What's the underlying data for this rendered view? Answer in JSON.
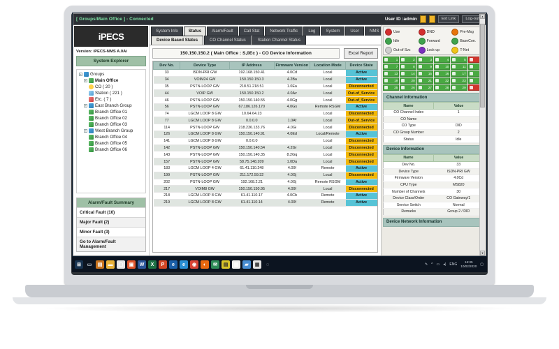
{
  "window": {
    "header_title": "[ Groups/Main Office ] - Connected",
    "user_label": "User ID :admin",
    "ext_link_label": "Ext Link",
    "logout_label": "Log-out"
  },
  "sidebar": {
    "logo_text": "iPECS",
    "version": "Version: iPECS-NMS A.0Ai",
    "explorer_title": "System Explorer",
    "tree": [
      {
        "label": "Groups",
        "depth": 0,
        "icon": "groups-icon",
        "bold": false
      },
      {
        "label": "Main Office",
        "depth": 1,
        "icon": "office-icon",
        "bold": true
      },
      {
        "label": "CO ( 20 )",
        "depth": 2,
        "icon": "co-icon",
        "bold": false
      },
      {
        "label": "Station ( 221 )",
        "depth": 2,
        "icon": "station-icon",
        "bold": false
      },
      {
        "label": "Etc. ( 7 )",
        "depth": 2,
        "icon": "etc-icon",
        "bold": false
      },
      {
        "label": "East Branch Group",
        "depth": 1,
        "icon": "groups-icon",
        "bold": false
      },
      {
        "label": "Branch Office 01",
        "depth": 2,
        "icon": "office-icon",
        "bold": false
      },
      {
        "label": "Branch Office 02",
        "depth": 2,
        "icon": "office-icon",
        "bold": false
      },
      {
        "label": "Branch Office 03",
        "depth": 2,
        "icon": "office-icon",
        "bold": false
      },
      {
        "label": "West Branch Group",
        "depth": 1,
        "icon": "groups-icon",
        "bold": false
      },
      {
        "label": "Branch Office 04",
        "depth": 2,
        "icon": "office-icon",
        "bold": false
      },
      {
        "label": "Branch Office 05",
        "depth": 2,
        "icon": "office-icon",
        "bold": false
      },
      {
        "label": "Branch Office 06",
        "depth": 2,
        "icon": "office-icon",
        "bold": false
      }
    ],
    "alarm_title": "Alarm/Fault Summary",
    "alarm_rows": [
      "Critical Fault (10)",
      "Major Fault (2)",
      "Minor Fault (3)",
      "Go to Alarm/Fault Management"
    ]
  },
  "tabs": {
    "primary": [
      "System Info",
      "Status",
      "Alarm/Fault",
      "Call Stat",
      "Network Traffic",
      "Log",
      "System",
      "User",
      "NMS"
    ],
    "primary_selected": "Status",
    "secondary": [
      "Device Based Status",
      "CO Channel Status",
      "Station Channel Status"
    ],
    "secondary_selected": "Device Based Status"
  },
  "main": {
    "table_title": "150.150.150.2 ( Main Office : S,0Ec ) - CO Device Information",
    "excel_button": "Excel Report",
    "columns": [
      "Dev No.",
      "Device Type",
      "IP Address",
      "Firmware Version",
      "Location Mode",
      "Device State"
    ],
    "rows": [
      [
        "33",
        "ISDN-PRI GW",
        "192.168.150.41",
        "4.0Cd",
        "Local",
        "Active"
      ],
      [
        "34",
        "VOIM24 GW",
        "150.150.150.3",
        "4.2Ba",
        "Local",
        "Active"
      ],
      [
        "35",
        "PSTN-LOOP GW",
        "218.51.218.51",
        "1.0Ea",
        "Local",
        "Disconnected"
      ],
      [
        "44",
        "VOIP GW",
        "150.150.150.2",
        "4.0Av",
        "Local",
        "Out-of_Service"
      ],
      [
        "46",
        "PSTN-LOOP GW",
        "150.150.140.55",
        "4.0Gg",
        "Local",
        "Out-of_Service"
      ],
      [
        "56",
        "PSTN-LOOP GW",
        "67.186.126.170",
        "4.0Gs",
        "Remote RSGM",
        "Active"
      ],
      [
        "74",
        "LGCM LOOP 8 GW",
        "10.64.64.23",
        "",
        "Local",
        "Disconnected"
      ],
      [
        "77",
        "LGCM LOOP 8 GW",
        "0.0.0.0",
        "1.0Af",
        "Local",
        "Out-of_Service"
      ],
      [
        "114",
        "PSTN-LOOP GW",
        "218.236.133.76",
        "4.0Gi",
        "Local",
        "Disconnected"
      ],
      [
        "126",
        "LGCM LOOP 8 GW",
        "150.150.140.91",
        "4.0Ed",
        "Local/Remote",
        "Active"
      ],
      [
        "141",
        "LGCM LOOP 8 GW",
        "0.0.0.0",
        "",
        "Local",
        "Disconnected"
      ],
      [
        "142",
        "PSTN-LOOP GW",
        "150.150.140.54",
        "4.2Gr",
        "Local",
        "Disconnected"
      ],
      [
        "143",
        "PSTN-LOOP GW",
        "150.150.140.35",
        "8.2Gq",
        "Local",
        "Disconnected"
      ],
      [
        "157",
        "PSTN-LOOP GW",
        "58.75.148.209",
        "1.0Da",
        "Local",
        "Disconnected"
      ],
      [
        "183",
        "LGCM LOOP 4 GW",
        "61.41.110.248",
        "4.00f",
        "Remote",
        "Active"
      ],
      [
        "199",
        "PSTN-LOOP GW",
        "211.172.59.32",
        "4.0Gj",
        "Local",
        "Disconnected"
      ],
      [
        "202",
        "PSTN-LOOP GW",
        "192.168.2.21",
        "4.0Gj",
        "Remote RSGM",
        "Active"
      ],
      [
        "217",
        "VOIM8 GW",
        "150.150.150.95",
        "4.00f",
        "Local",
        "Disconnected"
      ],
      [
        "218",
        "LGCM LOOP 8 GW",
        "61.41.110.17",
        "4.0Cb",
        "Remote",
        "Active"
      ],
      [
        "219",
        "LGCM LOOP 8 GW",
        "61.41.110.14",
        "4.00f",
        "Remote",
        "Active"
      ]
    ]
  },
  "right": {
    "legend": [
      {
        "label": "Use",
        "color": "#d32f2f",
        "icon": "handset-red-icon"
      },
      {
        "label": "DND",
        "color": "#d32f2f",
        "icon": "dnd-icon"
      },
      {
        "label": "Pre-Msg",
        "color": "#e8740c",
        "icon": "pre-msg-icon"
      },
      {
        "label": "Idle",
        "color": "#3fa34d",
        "icon": "handset-green-icon"
      },
      {
        "label": "Forward",
        "color": "#3fa34d",
        "icon": "forward-icon"
      },
      {
        "label": "BaseCon.",
        "color": "#3fa34d",
        "icon": "basecon-icon"
      },
      {
        "label": "Out-of Svc",
        "color": "#cfcfcf",
        "icon": "out-of-service-icon"
      },
      {
        "label": "Lock-up",
        "color": "#7b2fbe",
        "icon": "lockup-icon"
      },
      {
        "label": "T-Net",
        "color": "#f0c419",
        "icon": "tnet-icon"
      }
    ],
    "channel_count": 30,
    "channels_red": [
      6,
      30
    ],
    "channel_info_title": "Channel Information",
    "info_columns": [
      "Name",
      "Value"
    ],
    "channel_info": [
      [
        "CO Channel Index",
        "1"
      ],
      [
        "CO Name",
        ""
      ],
      [
        "CO Type",
        "DID"
      ],
      [
        "CO Group Number",
        "2"
      ],
      [
        "Status",
        "Idle"
      ]
    ],
    "device_info_title": "Device Information",
    "device_info": [
      [
        "Dev No.",
        "33"
      ],
      [
        "Device Type",
        "ISDN-PRI GW"
      ],
      [
        "Firmware Version",
        "4.0Cd"
      ],
      [
        "CPU Type",
        "MS820"
      ],
      [
        "Number of Channels",
        "30"
      ],
      [
        "Device Class/Order",
        "CO Gateway/1"
      ],
      [
        "Service Switch",
        "Normal"
      ],
      [
        "Remarks",
        "Group 2 / DID"
      ]
    ],
    "network_info_title": "Device Network Information"
  },
  "taskbar": {
    "lang": "ENG",
    "time": "16:35",
    "date": "10/02/2020",
    "icons": [
      {
        "name": "start-icon",
        "glyph": "⊞",
        "color": "#ffffff",
        "bg": "#17324f"
      },
      {
        "name": "search-icon",
        "glyph": "▭",
        "color": "#c9d4de",
        "bg": "#0c1420"
      },
      {
        "name": "task-view-icon",
        "glyph": "▤",
        "color": "#ffffff",
        "bg": "#c8741f"
      },
      {
        "name": "file-explorer-icon",
        "glyph": "▬",
        "color": "#ffffff",
        "bg": "#e8b23a"
      },
      {
        "name": "store-icon",
        "glyph": "▢",
        "color": "#ffffff",
        "bg": "#e6e6e6"
      },
      {
        "name": "office-icon",
        "glyph": "▣",
        "color": "#ffffff",
        "bg": "#e0562d"
      },
      {
        "name": "word-icon",
        "glyph": "W",
        "color": "#ffffff",
        "bg": "#2b579a"
      },
      {
        "name": "excel-icon",
        "glyph": "X",
        "color": "#ffffff",
        "bg": "#1e7145"
      },
      {
        "name": "powerpoint-icon",
        "glyph": "P",
        "color": "#ffffff",
        "bg": "#d24726"
      },
      {
        "name": "edge-legacy-icon",
        "glyph": "e",
        "color": "#ffffff",
        "bg": "#1b5fa8"
      },
      {
        "name": "edge-icon",
        "glyph": "e",
        "color": "#ffffff",
        "bg": "#2a8fd4"
      },
      {
        "name": "chrome-icon",
        "glyph": "◉",
        "color": "#ffffff",
        "bg": "#d94436"
      },
      {
        "name": "firefox-icon",
        "glyph": "◐",
        "color": "#ffffff",
        "bg": "#e8680f"
      },
      {
        "name": "mail-icon",
        "glyph": "✉",
        "color": "#ffffff",
        "bg": "#2e8b57"
      },
      {
        "name": "nms-app-icon",
        "glyph": "▤",
        "color": "#2b2b2b",
        "bg": "#d8c52a"
      },
      {
        "name": "notes-icon",
        "glyph": "▥",
        "color": "#ffffff",
        "bg": "#f0f0f0"
      },
      {
        "name": "folder-icon",
        "glyph": "▰",
        "color": "#ffffff",
        "bg": "#4a8fd4"
      },
      {
        "name": "calculator-icon",
        "glyph": "▦",
        "color": "#333333",
        "bg": "#e3e3e3"
      },
      {
        "name": "magnifier-icon",
        "glyph": "◌",
        "color": "#cfd6de",
        "bg": "#0c1420"
      }
    ]
  }
}
